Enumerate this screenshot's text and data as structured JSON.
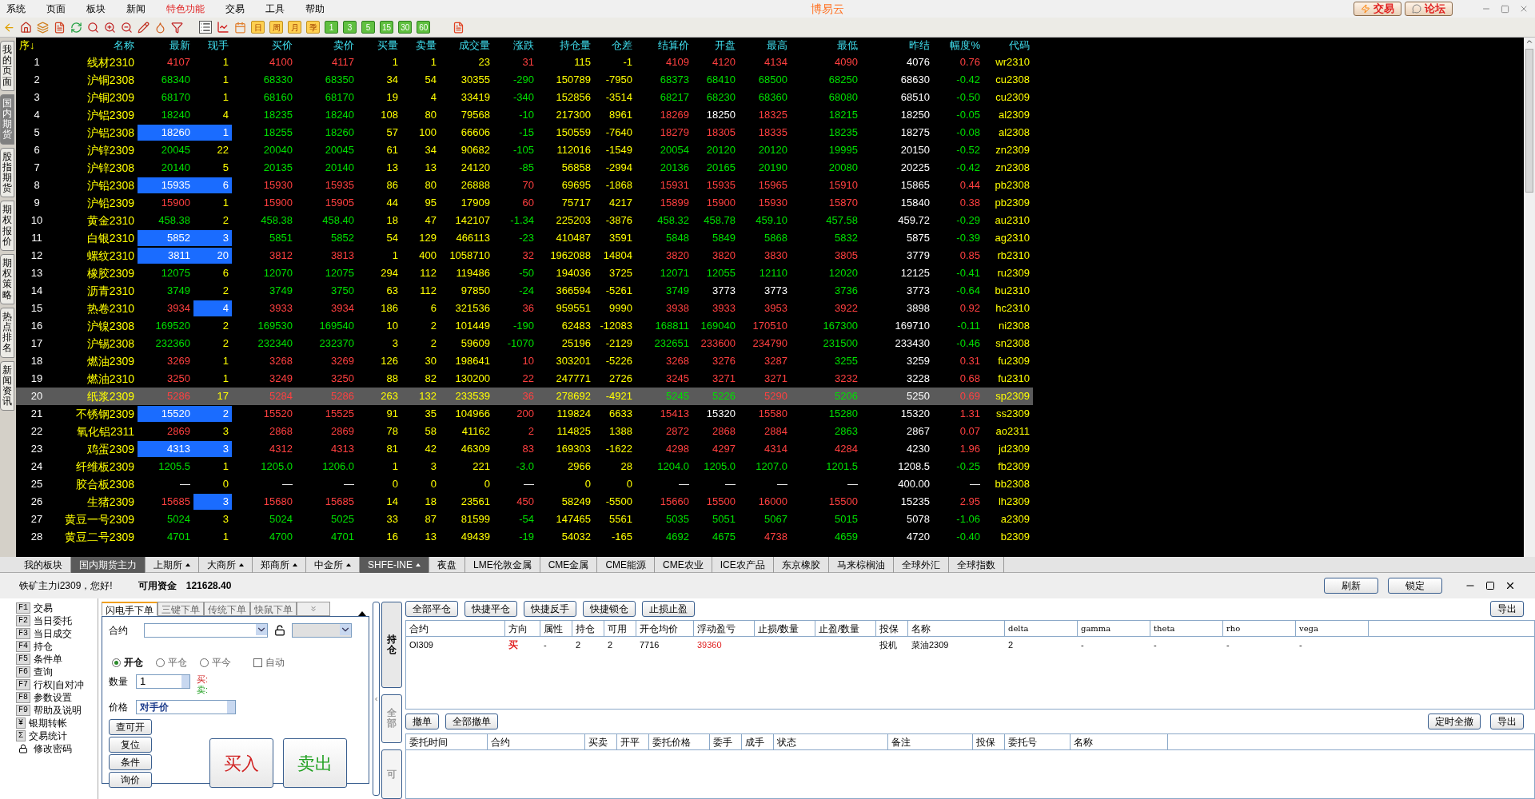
{
  "menu": [
    {
      "label": "系统",
      "highlighted": false
    },
    {
      "label": "页面",
      "highlighted": false
    },
    {
      "label": "板块",
      "highlighted": false
    },
    {
      "label": "新闻",
      "highlighted": false
    },
    {
      "label": "特色功能",
      "highlighted": true
    },
    {
      "label": "交易",
      "highlighted": false
    },
    {
      "label": "工具",
      "highlighted": false
    },
    {
      "label": "帮助",
      "highlighted": false
    }
  ],
  "app_title": "博易云",
  "top_buttons": [
    {
      "label": "交易",
      "kind": "trade"
    },
    {
      "label": "论坛",
      "kind": "forum"
    }
  ],
  "period_buttons": [
    {
      "label": "日",
      "kind": "period"
    },
    {
      "label": "周",
      "kind": "period"
    },
    {
      "label": "月",
      "kind": "period"
    },
    {
      "label": "季",
      "kind": "period"
    },
    {
      "label": "1",
      "kind": "minute"
    },
    {
      "label": "3",
      "kind": "minute"
    },
    {
      "label": "5",
      "kind": "minute"
    },
    {
      "label": "15",
      "kind": "minute"
    },
    {
      "label": "30",
      "kind": "minute"
    },
    {
      "label": "60",
      "kind": "minute"
    }
  ],
  "side_tabs": [
    {
      "label": "我的页面",
      "selected": false
    },
    {
      "label": "国内期货",
      "selected": true
    },
    {
      "label": "股指期货",
      "selected": false
    },
    {
      "label": "期权报价",
      "selected": false
    },
    {
      "label": "期权策略",
      "selected": false
    },
    {
      "label": "热点排名",
      "selected": false
    },
    {
      "label": "新闻资讯",
      "selected": false
    }
  ],
  "quote_table": {
    "columns": [
      {
        "label": "序↓",
        "kind": "index"
      },
      {
        "label": "名称",
        "kind": "name"
      },
      {
        "label": "最新",
        "kind": "price"
      },
      {
        "label": "现手",
        "kind": "qty"
      },
      {
        "label": "买价",
        "kind": "price"
      },
      {
        "label": "卖价",
        "kind": "price"
      },
      {
        "label": "买量",
        "kind": "qty"
      },
      {
        "label": "卖量",
        "kind": "qty"
      },
      {
        "label": "成交量",
        "kind": "qty"
      },
      {
        "label": "涨跌",
        "kind": "change"
      },
      {
        "label": "持仓量",
        "kind": "qty"
      },
      {
        "label": "仓差",
        "kind": "qty"
      },
      {
        "label": "结算价",
        "kind": "price"
      },
      {
        "label": "开盘",
        "kind": "price"
      },
      {
        "label": "最高",
        "kind": "price"
      },
      {
        "label": "最低",
        "kind": "price"
      },
      {
        "label": "昨结",
        "kind": "ref"
      },
      {
        "label": "幅度%",
        "kind": "change"
      },
      {
        "label": "代码",
        "kind": "code"
      }
    ],
    "rows": [
      {
        "selected": false,
        "last_flash": false,
        "vol_flash": false,
        "cells": [
          "1",
          "线材2310",
          "4107",
          "1",
          "4100",
          "4117",
          "1",
          "1",
          "23",
          "31",
          "115",
          "-1",
          "4109",
          "4120",
          "4134",
          "4090",
          "4076",
          "0.76",
          "wr2310"
        ]
      },
      {
        "selected": false,
        "last_flash": false,
        "vol_flash": false,
        "cells": [
          "2",
          "沪铜2308",
          "68340",
          "1",
          "68330",
          "68350",
          "34",
          "54",
          "30355",
          "-290",
          "150789",
          "-7950",
          "68373",
          "68410",
          "68500",
          "68250",
          "68630",
          "-0.42",
          "cu2308"
        ]
      },
      {
        "selected": false,
        "last_flash": false,
        "vol_flash": false,
        "cells": [
          "3",
          "沪铜2309",
          "68170",
          "1",
          "68160",
          "68170",
          "19",
          "4",
          "33419",
          "-340",
          "152856",
          "-3514",
          "68217",
          "68230",
          "68360",
          "68080",
          "68510",
          "-0.50",
          "cu2309"
        ]
      },
      {
        "selected": false,
        "last_flash": false,
        "vol_flash": false,
        "cells": [
          "4",
          "沪铝2309",
          "18240",
          "4",
          "18235",
          "18240",
          "108",
          "80",
          "79568",
          "-10",
          "217300",
          "8961",
          "18269",
          "18250",
          "18325",
          "18215",
          "18250",
          "-0.05",
          "al2309"
        ]
      },
      {
        "selected": false,
        "last_flash": true,
        "vol_flash": true,
        "cells": [
          "5",
          "沪铝2308",
          "18260",
          "1",
          "18255",
          "18260",
          "57",
          "100",
          "66606",
          "-15",
          "150559",
          "-7640",
          "18279",
          "18305",
          "18335",
          "18235",
          "18275",
          "-0.08",
          "al2308"
        ]
      },
      {
        "selected": false,
        "last_flash": false,
        "vol_flash": false,
        "cells": [
          "6",
          "沪锌2309",
          "20045",
          "22",
          "20040",
          "20045",
          "61",
          "34",
          "90682",
          "-105",
          "112016",
          "-1549",
          "20054",
          "20120",
          "20120",
          "19995",
          "20150",
          "-0.52",
          "zn2309"
        ]
      },
      {
        "selected": false,
        "last_flash": false,
        "vol_flash": false,
        "cells": [
          "7",
          "沪锌2308",
          "20140",
          "5",
          "20135",
          "20140",
          "13",
          "13",
          "24120",
          "-85",
          "56858",
          "-2994",
          "20136",
          "20165",
          "20190",
          "20080",
          "20225",
          "-0.42",
          "zn2308"
        ]
      },
      {
        "selected": false,
        "last_flash": true,
        "vol_flash": true,
        "cells": [
          "8",
          "沪铅2308",
          "15935",
          "6",
          "15930",
          "15935",
          "86",
          "80",
          "26888",
          "70",
          "69695",
          "-1868",
          "15931",
          "15935",
          "15965",
          "15910",
          "15865",
          "0.44",
          "pb2308"
        ]
      },
      {
        "selected": false,
        "last_flash": false,
        "vol_flash": false,
        "cells": [
          "9",
          "沪铅2309",
          "15900",
          "1",
          "15900",
          "15905",
          "44",
          "95",
          "17909",
          "60",
          "75717",
          "4217",
          "15899",
          "15900",
          "15930",
          "15870",
          "15840",
          "0.38",
          "pb2309"
        ]
      },
      {
        "selected": false,
        "last_flash": false,
        "vol_flash": false,
        "cells": [
          "10",
          "黄金2310",
          "458.38",
          "2",
          "458.38",
          "458.40",
          "18",
          "47",
          "142107",
          "-1.34",
          "225203",
          "-3876",
          "458.32",
          "458.78",
          "459.10",
          "457.58",
          "459.72",
          "-0.29",
          "au2310"
        ]
      },
      {
        "selected": false,
        "last_flash": true,
        "vol_flash": true,
        "cells": [
          "11",
          "白银2310",
          "5852",
          "3",
          "5851",
          "5852",
          "54",
          "129",
          "466113",
          "-23",
          "410487",
          "3591",
          "5848",
          "5849",
          "5868",
          "5832",
          "5875",
          "-0.39",
          "ag2310"
        ]
      },
      {
        "selected": false,
        "last_flash": true,
        "vol_flash": true,
        "cells": [
          "12",
          "螺纹2310",
          "3811",
          "20",
          "3812",
          "3813",
          "1",
          "400",
          "1058710",
          "32",
          "1962088",
          "14804",
          "3820",
          "3820",
          "3830",
          "3805",
          "3779",
          "0.85",
          "rb2310"
        ]
      },
      {
        "selected": false,
        "last_flash": false,
        "vol_flash": false,
        "cells": [
          "13",
          "橡胶2309",
          "12075",
          "6",
          "12070",
          "12075",
          "294",
          "112",
          "119486",
          "-50",
          "194036",
          "3725",
          "12071",
          "12055",
          "12110",
          "12020",
          "12125",
          "-0.41",
          "ru2309"
        ]
      },
      {
        "selected": false,
        "last_flash": false,
        "vol_flash": false,
        "cells": [
          "14",
          "沥青2310",
          "3749",
          "2",
          "3749",
          "3750",
          "63",
          "112",
          "97850",
          "-24",
          "366594",
          "-5261",
          "3749",
          "3773",
          "3773",
          "3736",
          "3773",
          "-0.64",
          "bu2310"
        ]
      },
      {
        "selected": false,
        "last_flash": false,
        "vol_flash": true,
        "cells": [
          "15",
          "热卷2310",
          "3934",
          "4",
          "3933",
          "3934",
          "186",
          "6",
          "321536",
          "36",
          "959551",
          "9990",
          "3938",
          "3933",
          "3953",
          "3922",
          "3898",
          "0.92",
          "hc2310"
        ]
      },
      {
        "selected": false,
        "last_flash": false,
        "vol_flash": false,
        "cells": [
          "16",
          "沪镍2308",
          "169520",
          "2",
          "169530",
          "169540",
          "10",
          "2",
          "101449",
          "-190",
          "62483",
          "-12083",
          "168811",
          "169040",
          "170510",
          "167300",
          "169710",
          "-0.11",
          "ni2308"
        ]
      },
      {
        "selected": false,
        "last_flash": false,
        "vol_flash": false,
        "cells": [
          "17",
          "沪锡2308",
          "232360",
          "2",
          "232340",
          "232370",
          "3",
          "2",
          "59609",
          "-1070",
          "25196",
          "-2129",
          "232651",
          "233600",
          "234790",
          "231500",
          "233430",
          "-0.46",
          "sn2308"
        ]
      },
      {
        "selected": false,
        "last_flash": false,
        "vol_flash": false,
        "cells": [
          "18",
          "燃油2309",
          "3269",
          "1",
          "3268",
          "3269",
          "126",
          "30",
          "198641",
          "10",
          "303201",
          "-5226",
          "3268",
          "3276",
          "3287",
          "3255",
          "3259",
          "0.31",
          "fu2309"
        ]
      },
      {
        "selected": false,
        "last_flash": false,
        "vol_flash": false,
        "cells": [
          "19",
          "燃油2310",
          "3250",
          "1",
          "3249",
          "3250",
          "88",
          "82",
          "130200",
          "22",
          "247771",
          "2726",
          "3245",
          "3271",
          "3271",
          "3232",
          "3228",
          "0.68",
          "fu2310"
        ]
      },
      {
        "selected": true,
        "last_flash": false,
        "vol_flash": false,
        "cells": [
          "20",
          "纸浆2309",
          "5286",
          "17",
          "5284",
          "5286",
          "263",
          "132",
          "233539",
          "36",
          "278692",
          "-4921",
          "5245",
          "5226",
          "5290",
          "5206",
          "5250",
          "0.69",
          "sp2309"
        ]
      },
      {
        "selected": false,
        "last_flash": true,
        "vol_flash": true,
        "cells": [
          "21",
          "不锈钢2309",
          "15520",
          "2",
          "15520",
          "15525",
          "91",
          "35",
          "104966",
          "200",
          "119824",
          "6633",
          "15413",
          "15320",
          "15580",
          "15280",
          "15320",
          "1.31",
          "ss2309"
        ]
      },
      {
        "selected": false,
        "last_flash": false,
        "vol_flash": false,
        "cells": [
          "22",
          "氧化铝2311",
          "2869",
          "3",
          "2868",
          "2869",
          "78",
          "58",
          "41162",
          "2",
          "114825",
          "1388",
          "2872",
          "2868",
          "2884",
          "2863",
          "2867",
          "0.07",
          "ao2311"
        ]
      },
      {
        "selected": false,
        "last_flash": true,
        "vol_flash": true,
        "cells": [
          "23",
          "鸡蛋2309",
          "4313",
          "3",
          "4312",
          "4313",
          "81",
          "42",
          "46309",
          "83",
          "169303",
          "-1622",
          "4298",
          "4297",
          "4314",
          "4284",
          "4230",
          "1.96",
          "jd2309"
        ]
      },
      {
        "selected": false,
        "last_flash": false,
        "vol_flash": false,
        "cells": [
          "24",
          "纤维板2309",
          "1205.5",
          "1",
          "1205.0",
          "1206.0",
          "1",
          "3",
          "221",
          "-3.0",
          "2966",
          "28",
          "1204.0",
          "1205.0",
          "1207.0",
          "1201.5",
          "1208.5",
          "-0.25",
          "fb2309"
        ]
      },
      {
        "selected": false,
        "last_flash": false,
        "vol_flash": false,
        "cells": [
          "25",
          "胶合板2308",
          "—",
          "0",
          "—",
          "—",
          "0",
          "0",
          "0",
          "—",
          "0",
          "0",
          "—",
          "—",
          "—",
          "—",
          "400.00",
          "—",
          "bb2308"
        ]
      },
      {
        "selected": false,
        "last_flash": false,
        "vol_flash": true,
        "cells": [
          "26",
          "生猪2309",
          "15685",
          "3",
          "15680",
          "15685",
          "14",
          "18",
          "23561",
          "450",
          "58249",
          "-5500",
          "15660",
          "15500",
          "16000",
          "15500",
          "15235",
          "2.95",
          "lh2309"
        ]
      },
      {
        "selected": false,
        "last_flash": false,
        "vol_flash": false,
        "cells": [
          "27",
          "黄豆一号2309",
          "5024",
          "3",
          "5024",
          "5025",
          "33",
          "87",
          "81599",
          "-54",
          "147465",
          "5561",
          "5035",
          "5051",
          "5067",
          "5015",
          "5078",
          "-1.06",
          "a2309"
        ]
      },
      {
        "selected": false,
        "last_flash": false,
        "vol_flash": false,
        "cells": [
          "28",
          "黄豆二号2309",
          "4701",
          "1",
          "4700",
          "4701",
          "16",
          "13",
          "49439",
          "-19",
          "54032",
          "-165",
          "4692",
          "4675",
          "4738",
          "4659",
          "4720",
          "-0.40",
          "b2309"
        ]
      }
    ]
  },
  "board_tabs": [
    {
      "label": "我的板块",
      "selected": false,
      "dropdown": false
    },
    {
      "label": "国内期货主力",
      "selected": true,
      "dropdown": false
    },
    {
      "label": "上期所",
      "selected": false,
      "dropdown": true
    },
    {
      "label": "大商所",
      "selected": false,
      "dropdown": true
    },
    {
      "label": "郑商所",
      "selected": false,
      "dropdown": true
    },
    {
      "label": "中金所",
      "selected": false,
      "dropdown": true
    },
    {
      "label": "SHFE-INE",
      "selected": true,
      "dropdown": true
    },
    {
      "label": "夜盘",
      "selected": false,
      "dropdown": false
    },
    {
      "label": "LME伦敦金属",
      "selected": false,
      "dropdown": false
    },
    {
      "label": "CME金属",
      "selected": false,
      "dropdown": false
    },
    {
      "label": "CME能源",
      "selected": false,
      "dropdown": false
    },
    {
      "label": "CME农业",
      "selected": false,
      "dropdown": false
    },
    {
      "label": "ICE农产品",
      "selected": false,
      "dropdown": false
    },
    {
      "label": "东京橡胶",
      "selected": false,
      "dropdown": false
    },
    {
      "label": "马来棕榈油",
      "selected": false,
      "dropdown": false
    },
    {
      "label": "全球外汇",
      "selected": false,
      "dropdown": false
    },
    {
      "label": "全球指数",
      "selected": false,
      "dropdown": false
    }
  ],
  "account": {
    "greeting": "铁矿主力i2309，您好!",
    "funds_label": "可用资金",
    "funds": "121628.40"
  },
  "header_buttons": [
    "刷新",
    "锁定"
  ],
  "func_tree": [
    {
      "key": "F1",
      "label": "交易",
      "kind": "key"
    },
    {
      "key": "F2",
      "label": "当日委托",
      "kind": "key"
    },
    {
      "key": "F3",
      "label": "当日成交",
      "kind": "key"
    },
    {
      "key": "F4",
      "label": "持仓",
      "kind": "key"
    },
    {
      "key": "F5",
      "label": "条件单",
      "kind": "key"
    },
    {
      "key": "F6",
      "label": "查询",
      "kind": "key"
    },
    {
      "key": "F7",
      "label": "行权|自对冲",
      "kind": "key"
    },
    {
      "key": "F8",
      "label": "参数设置",
      "kind": "key"
    },
    {
      "key": "F9",
      "label": "帮助及说明",
      "kind": "key"
    },
    {
      "key": "¥",
      "label": "银期转帐",
      "kind": "key"
    },
    {
      "key": "Σ",
      "label": "交易统计",
      "kind": "key"
    },
    {
      "label": "修改密码",
      "kind": "lock"
    }
  ],
  "order": {
    "tabs": [
      {
        "label": "闪电手下单",
        "selected": true
      },
      {
        "label": "三键下单",
        "selected": false
      },
      {
        "label": "传统下单",
        "selected": false
      },
      {
        "label": "快鼠下单",
        "selected": false
      }
    ],
    "contract_label": "合约",
    "open_close": [
      {
        "label": "开仓",
        "selected": true
      },
      {
        "label": "平仓",
        "selected": false
      },
      {
        "label": "平今",
        "selected": false
      }
    ],
    "auto": {
      "label": "自动",
      "checked": false
    },
    "qty_label": "数量",
    "qty": "1",
    "buy_hint": "买:",
    "sell_hint": "卖:",
    "price_label": "价格",
    "price": "对手价",
    "small_buttons": [
      "查可开",
      "复位",
      "条件",
      "询价"
    ],
    "buy": "买入",
    "sell": "卖出"
  },
  "panel_tabs": [
    {
      "label": "持仓",
      "selected": true
    },
    {
      "label": "全部",
      "selected": false
    },
    {
      "label": "可",
      "selected": false
    }
  ],
  "positions": {
    "buttons": [
      "全部平仓",
      "快捷平仓",
      "快捷反手",
      "快捷锁仓",
      "止损止盈"
    ],
    "export": "导出",
    "columns": [
      "合约",
      "方向",
      "属性",
      "持仓",
      "可用",
      "开仓均价",
      "浮动盈亏",
      "止损/数量",
      "止盈/数量",
      "投保",
      "名称",
      "delta",
      "gamma",
      "theta",
      "rho",
      "vega"
    ],
    "rows": [
      {
        "color": "#e02020",
        "cells": [
          "OI309",
          "买",
          "-",
          "2",
          "2",
          "7716",
          "39360",
          "",
          "",
          "投机",
          "菜油2309",
          "2",
          "-",
          "-",
          "-",
          "-"
        ]
      }
    ]
  },
  "orders": {
    "buttons": [
      "撤单",
      "全部撤单"
    ],
    "right_buttons": [
      "定时全撤",
      "导出"
    ],
    "columns": [
      "委托时间",
      "合约",
      "买卖",
      "开平",
      "委托价格",
      "委手",
      "成手",
      "状态",
      "备注",
      "投保",
      "委托号",
      "名称"
    ]
  }
}
